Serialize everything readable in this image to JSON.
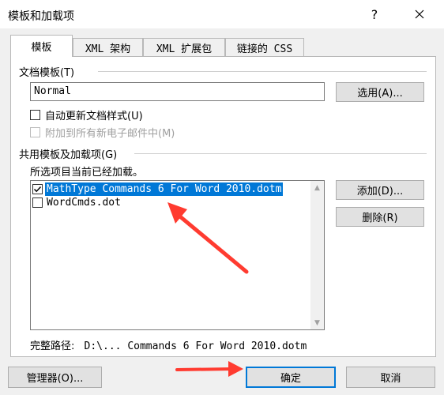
{
  "window": {
    "title": "模板和加载项",
    "help_label": "?"
  },
  "tabs": [
    {
      "label": "模板",
      "active": true
    },
    {
      "label": "XML 架构"
    },
    {
      "label": "XML 扩展包"
    },
    {
      "label": "链接的 CSS"
    }
  ],
  "document_template": {
    "section_label": "文档模板(T)",
    "value": "Normal",
    "select_button": "选用(A)..."
  },
  "options": {
    "auto_update_label": "自动更新文档样式(U)",
    "auto_update_checked": false,
    "attach_email_label": "附加到所有新电子邮件中(M)",
    "attach_email_checked": false,
    "attach_email_disabled": true
  },
  "global_templates": {
    "section_label": "共用模板及加载项(G)",
    "hint": "所选项目当前已经加载。",
    "items": [
      {
        "label": "MathType Commands 6 For Word 2010.dotm",
        "checked": true,
        "selected": true
      },
      {
        "label": "WordCmds.dot",
        "checked": false,
        "selected": false
      }
    ],
    "add_button": "添加(D)...",
    "remove_button": "删除(R)",
    "full_path_label": "完整路径:",
    "full_path_value": "D:\\... Commands 6 For Word 2010.dotm"
  },
  "footer": {
    "organizer_button": "管理器(O)...",
    "ok_button": "确定",
    "cancel_button": "取消"
  },
  "colors": {
    "accent": "#0078d7",
    "annotation": "#ff3b30"
  }
}
